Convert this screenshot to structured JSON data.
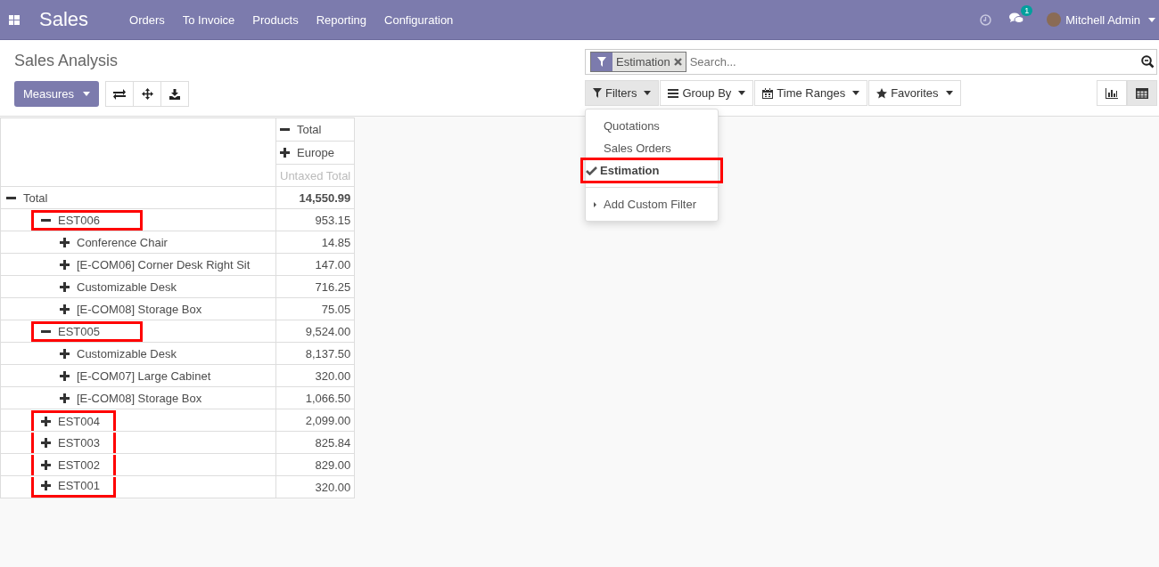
{
  "navbar": {
    "app_name": "Sales",
    "menu": [
      "Orders",
      "To Invoice",
      "Products",
      "Reporting",
      "Configuration"
    ],
    "message_count": "1",
    "user_name": "Mitchell Admin"
  },
  "title": "Sales Analysis",
  "measures_button": "Measures",
  "search": {
    "facet": "Estimation",
    "placeholder": "Search..."
  },
  "search_buttons": [
    {
      "kind": "filter",
      "label": "Filters",
      "open": true
    },
    {
      "kind": "group",
      "label": "Group By",
      "open": false
    },
    {
      "kind": "time",
      "label": "Time Ranges",
      "open": false
    },
    {
      "kind": "fav",
      "label": "Favorites",
      "open": false
    }
  ],
  "views": [
    {
      "kind": "graph",
      "selected": false
    },
    {
      "kind": "pivot",
      "selected": true
    }
  ],
  "filters_menu": [
    {
      "kind": "option",
      "label": "Quotations",
      "selected": false
    },
    {
      "kind": "option",
      "label": "Sales Orders",
      "selected": false
    },
    {
      "kind": "option",
      "label": "Estimation",
      "selected": true,
      "highlighted": true
    },
    {
      "kind": "submenu",
      "label": "Add Custom Filter"
    }
  ],
  "pivot": {
    "column_headers": [
      {
        "label": "Total",
        "expanded": true
      },
      {
        "label": "Europe",
        "expanded": false
      }
    ],
    "measure": "Untaxed Total",
    "rows": [
      {
        "label": "Total",
        "value": "14,550.99",
        "expanded": true,
        "highlighted": false,
        "children": [
          {
            "label": "EST006",
            "value": "953.15",
            "expanded": true,
            "highlighted": true,
            "children": [
              {
                "label": "Conference Chair",
                "value": "14.85",
                "expanded": false,
                "highlighted": false
              },
              {
                "label": "[E-COM06] Corner Desk Right Sit",
                "value": "147.00",
                "expanded": false,
                "highlighted": false
              },
              {
                "label": "Customizable Desk",
                "value": "716.25",
                "expanded": false,
                "highlighted": false
              },
              {
                "label": "[E-COM08] Storage Box",
                "value": "75.05",
                "expanded": false,
                "highlighted": false
              }
            ]
          },
          {
            "label": "EST005",
            "value": "9,524.00",
            "expanded": true,
            "highlighted": true,
            "children": [
              {
                "label": "Customizable Desk",
                "value": "8,137.50",
                "expanded": false,
                "highlighted": false
              },
              {
                "label": "[E-COM07] Large Cabinet",
                "value": "320.00",
                "expanded": false,
                "highlighted": false
              },
              {
                "label": "[E-COM08] Storage Box",
                "value": "1,066.50",
                "expanded": false,
                "highlighted": false
              }
            ]
          },
          {
            "label": "EST004",
            "value": "2,099.00",
            "expanded": false,
            "highlighted": true
          },
          {
            "label": "EST003",
            "value": "825.84",
            "expanded": false,
            "highlighted": true
          },
          {
            "label": "EST002",
            "value": "829.00",
            "expanded": false,
            "highlighted": true
          },
          {
            "label": "EST001",
            "value": "320.00",
            "expanded": false,
            "highlighted": true
          }
        ]
      }
    ]
  }
}
